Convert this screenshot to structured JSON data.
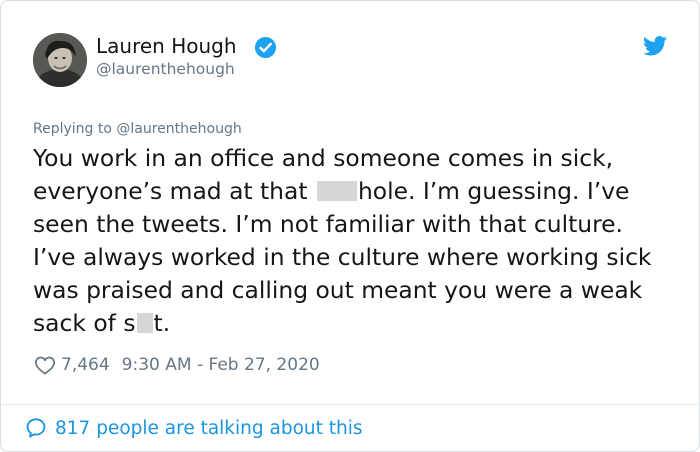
{
  "author": {
    "name": "Lauren Hough",
    "handle": "@laurenthehough",
    "avatar_icon": "profile-photo",
    "verified_icon": "verified-badge-icon"
  },
  "brand": {
    "icon": "twitter-bird-icon",
    "color": "#1da1f2"
  },
  "reply": {
    "text": "Replying to @laurenthehough"
  },
  "tweet": {
    "lines": [
      "You work in an office and someone comes in sick,",
      "everyone’s mad at that ",
      "hole. I’m guessing. I’ve",
      "seen the tweets. I’m not familiar with that culture.",
      "I’ve always worked in the culture where working sick",
      "was praised and calling out meant you were a weak",
      "sack of s",
      "t."
    ]
  },
  "meta": {
    "likes": "7,464",
    "timestamp": "9:30 AM - Feb 27, 2020"
  },
  "footer": {
    "talking": "817 people are talking about this"
  },
  "colors": {
    "text": "#14171a",
    "muted": "#657786",
    "link": "#1b95e0",
    "censor": "#d6d6d6"
  }
}
